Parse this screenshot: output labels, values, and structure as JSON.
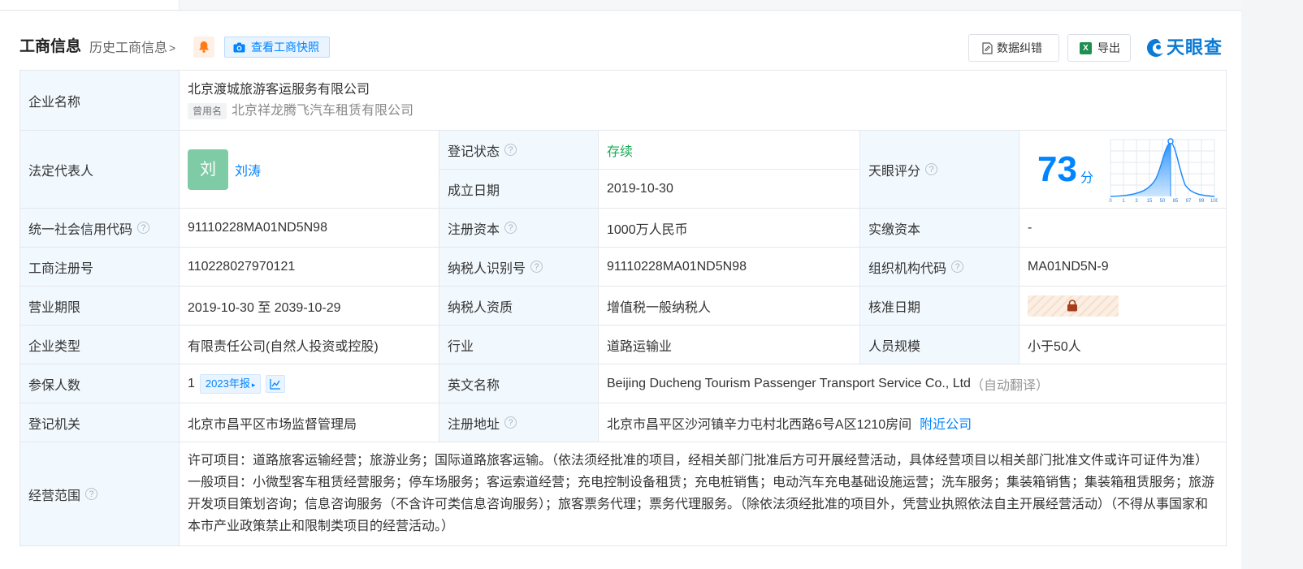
{
  "header": {
    "title": "工商信息",
    "history_label": "历史工商信息",
    "snapshot_button": "查看工商快照",
    "data_fix_button": "数据纠错",
    "export_button": "导出",
    "logo_text": "天眼查",
    "brand_color": "#0084ff"
  },
  "company": {
    "name_label": "企业名称",
    "name": "北京渡城旅游客运服务有限公司",
    "former_name_tag": "曾用名",
    "former_name": "北京祥龙腾飞汽车租赁有限公司",
    "legal_rep_label": "法定代表人",
    "legal_rep_avatar": "刘",
    "legal_rep": "刘涛",
    "status_label": "登记状态",
    "status": "存续",
    "found_date_label": "成立日期",
    "found_date": "2019-10-30",
    "score_label": "天眼评分",
    "score": "73",
    "score_unit": "分",
    "score_axis": [
      "0",
      "1",
      "3",
      "15",
      "50",
      "85",
      "97",
      "99",
      "100"
    ],
    "credit_code_label": "统一社会信用代码",
    "credit_code": "91110228MA01ND5N98",
    "reg_capital_label": "注册资本",
    "reg_capital": "1000万人民币",
    "paid_capital_label": "实缴资本",
    "paid_capital": "-",
    "reg_no_label": "工商注册号",
    "reg_no": "110228027970121",
    "taxpayer_id_label": "纳税人识别号",
    "taxpayer_id": "91110228MA01ND5N98",
    "org_code_label": "组织机构代码",
    "org_code": "MA01ND5N-9",
    "term_label": "营业期限",
    "term": "2019-10-30 至 2039-10-29",
    "tax_qual_label": "纳税人资质",
    "tax_qual": "增值税一般纳税人",
    "approve_date_label": "核准日期",
    "type_label": "企业类型",
    "type": "有限责任公司(自然人投资或控股)",
    "industry_label": "行业",
    "industry": "道路运输业",
    "staff_label": "人员规模",
    "staff": "小于50人",
    "insured_label": "参保人数",
    "insured": "1",
    "report_tag": "2023年报",
    "english_label": "英文名称",
    "english_name": "Beijing Ducheng Tourism Passenger Transport Service Co., Ltd",
    "auto_translate": "（自动翻译）",
    "authority_label": "登记机关",
    "authority": "北京市昌平区市场监督管理局",
    "address_label": "注册地址",
    "address": "北京市昌平区沙河镇辛力屯村北西路6号A区1210房间",
    "nearby_link": "附近公司",
    "scope_label": "经营范围",
    "scope": "许可项目：道路旅客运输经营；旅游业务；国际道路旅客运输。（依法须经批准的项目，经相关部门批准后方可开展经营活动，具体经营项目以相关部门批准文件或许可证件为准）一般项目：小微型客车租赁经营服务；停车场服务；客运索道经营；充电控制设备租赁；充电桩销售；电动汽车充电基础设施运营；洗车服务；集装箱销售；集装箱租赁服务；旅游开发项目策划咨询；信息咨询服务（不含许可类信息咨询服务）；旅客票务代理；票务代理服务。（除依法须经批准的项目外，凭营业执照依法自主开展经营活动）（不得从事国家和本市产业政策禁止和限制类项目的经营活动。）"
  }
}
